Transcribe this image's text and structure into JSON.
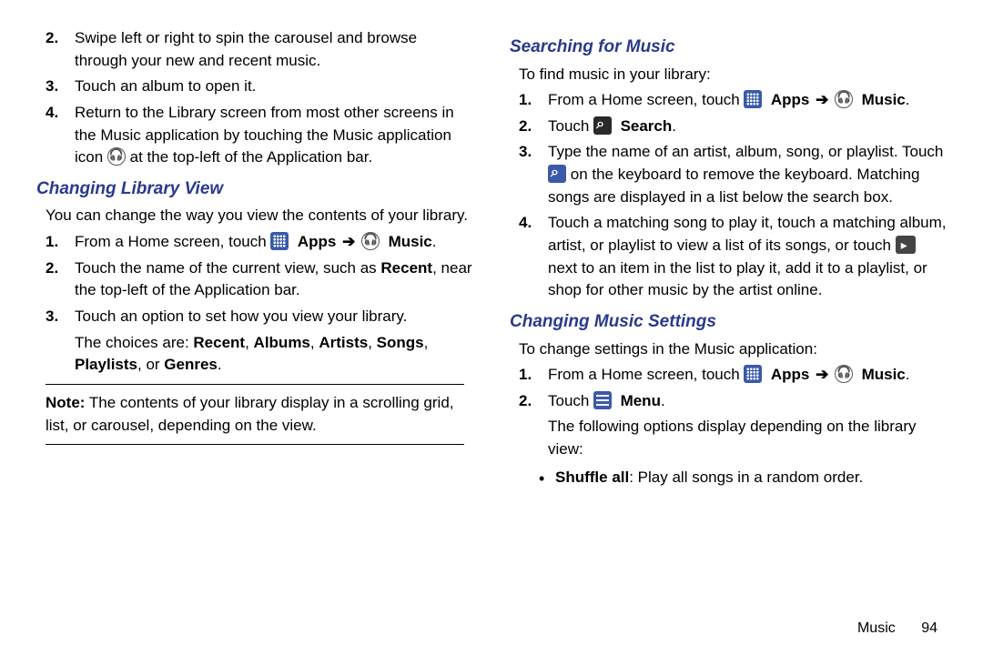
{
  "col1": {
    "steps_top": [
      {
        "n": "2.",
        "text": "Swipe left or right to spin the carousel and browse through your new and recent music."
      },
      {
        "n": "3.",
        "text": "Touch an album to open it."
      },
      {
        "n": "4.",
        "text_a": "Return to the Library screen from most other screens in the Music application by touching the Music application icon ",
        "text_b": " at the top-left of the Application bar."
      }
    ],
    "h1": "Changing Library View",
    "intro1": "You can change the way you view the contents of your library.",
    "steps_lib": {
      "s1": {
        "n": "1.",
        "a": "From a Home screen, touch ",
        "apps": "Apps",
        "arrow": "➔",
        "music": "Music",
        "dot": "."
      },
      "s2": {
        "n": "2.",
        "a": "Touch the name of the current view, such as ",
        "b": "Recent",
        "c": ", near the top-left of the Application bar."
      },
      "s3": {
        "n": "3.",
        "a": "Touch an option to set how you view your library.",
        "sub_a": "The choices are: ",
        "sub_b": "Recent",
        "sub_c": ", ",
        "sub_d": "Albums",
        "sub_e": ", ",
        "sub_f": "Artists",
        "sub_g": ", ",
        "sub_h": "Songs",
        "sub_i": ", ",
        "sub_j": "Playlists",
        "sub_k": ", or ",
        "sub_l": "Genres",
        "sub_m": "."
      }
    },
    "note_label": "Note:",
    "note_text": " The contents of your library display in a scrolling grid, list, or carousel, depending on the view."
  },
  "col2": {
    "h1": "Searching for Music",
    "intro1": "To find music in your library:",
    "search": {
      "s1": {
        "n": "1.",
        "a": "From a Home screen, touch ",
        "apps": "Apps",
        "arrow": "➔",
        "music": "Music",
        "dot": "."
      },
      "s2": {
        "n": "2.",
        "a": "Touch ",
        "b": "Search",
        "c": "."
      },
      "s3": {
        "n": "3.",
        "a": "Type the name of an artist, album, song, or playlist. Touch ",
        "b": " on the keyboard to remove the keyboard. Matching songs are displayed in a list below the search box."
      },
      "s4": {
        "n": "4.",
        "a": "Touch a matching song to play it, touch a matching album, artist, or playlist to view a list of its songs, or touch ",
        "b": " next to an item in the list to play it, add it to a playlist, or shop for other music by the artist online."
      }
    },
    "h2": "Changing Music Settings",
    "intro2": "To change settings in the Music application:",
    "settings": {
      "s1": {
        "n": "1.",
        "a": "From a Home screen, touch ",
        "apps": "Apps",
        "arrow": "➔",
        "music": "Music",
        "dot": "."
      },
      "s2": {
        "n": "2.",
        "a": "Touch ",
        "b": "Menu",
        "c": ".",
        "sub": "The following options display depending on the library view:"
      }
    },
    "bullet_label": "Shuffle all",
    "bullet_text": ": Play all songs in a random order."
  },
  "footer": {
    "section": "Music",
    "page": "94"
  }
}
